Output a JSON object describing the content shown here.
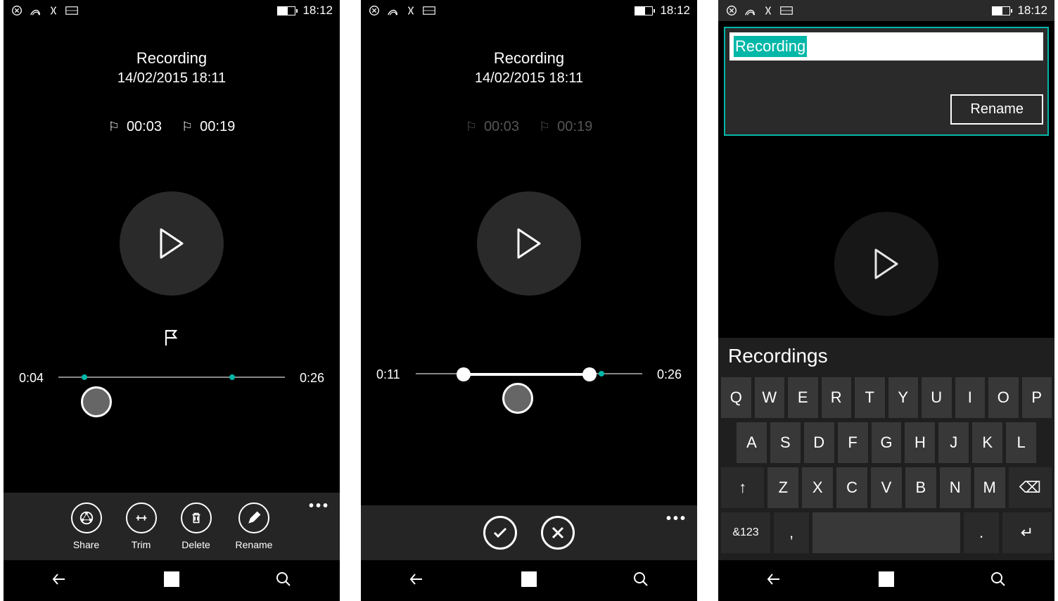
{
  "status": {
    "time": "18:12"
  },
  "screen1": {
    "title": "Recording",
    "date": "14/02/2015 18:11",
    "flags": [
      "00:03",
      "00:19"
    ],
    "cur": "0:04",
    "total": "0:26",
    "markPct1": 11,
    "markPct2": 73,
    "thumbPct": 16,
    "appbar": {
      "share": "Share",
      "trim": "Trim",
      "delete": "Delete",
      "rename": "Rename"
    }
  },
  "screen2": {
    "title": "Recording",
    "date": "14/02/2015 18:11",
    "flags": [
      "00:03",
      "00:19"
    ],
    "cur": "0:11",
    "total": "0:26",
    "trimStartPct": 20,
    "trimEndPct": 73,
    "thumbPct": 43
  },
  "screen3": {
    "input": "Recording",
    "renameBtn": "Rename",
    "suggestion": "Recordings",
    "keyboard": {
      "row1": [
        "Q",
        "W",
        "E",
        "R",
        "T",
        "Y",
        "U",
        "I",
        "O",
        "P"
      ],
      "row2": [
        "A",
        "S",
        "D",
        "F",
        "G",
        "H",
        "J",
        "K",
        "L"
      ],
      "row3": [
        "Z",
        "X",
        "C",
        "V",
        "B",
        "N",
        "M"
      ],
      "shift": "↑",
      "backspace": "⌫",
      "numkey": "&123",
      "comma": ",",
      "period": ".",
      "enter": "↵"
    }
  }
}
